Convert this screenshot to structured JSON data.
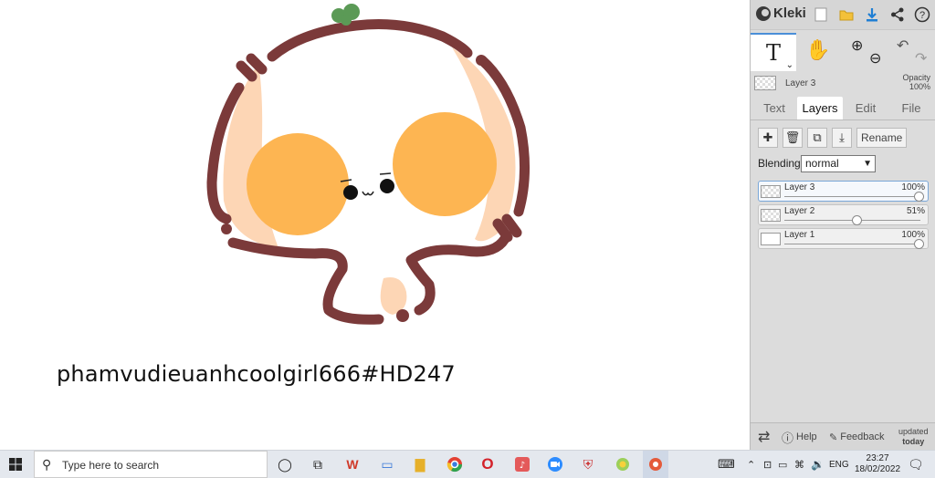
{
  "canvas": {
    "signature_text": "phamvudieuanhcoolgirl666#HD247"
  },
  "panel": {
    "brand": "Kleki",
    "toolbar_icons": [
      "new-file-icon",
      "open-folder-icon",
      "download-icon",
      "share-icon",
      "help-icon"
    ],
    "tool_text_label": "T",
    "active_layer_name": "Layer 3",
    "opacity_label": "Opacity",
    "opacity_value": "100%",
    "tabs": [
      "Text",
      "Layers",
      "Edit",
      "File"
    ],
    "active_tab": "Layers",
    "rename_label": "Rename",
    "blending_label": "Blending",
    "blending_value": "normal",
    "layers": [
      {
        "name": "Layer 3",
        "opacity_label": "100%",
        "opacity": 1.0,
        "selected": true
      },
      {
        "name": "Layer 2",
        "opacity_label": "51%",
        "opacity": 0.51,
        "selected": false
      },
      {
        "name": "Layer 1",
        "opacity_label": "100%",
        "opacity": 1.0,
        "selected": false
      }
    ],
    "bottom": {
      "help_label": "Help",
      "feedback_label": "Feedback",
      "updated_line1": "updated",
      "updated_line2": "today"
    }
  },
  "taskbar": {
    "search_placeholder": "Type here to search",
    "language": "ENG",
    "time": "23:27",
    "date": "18/02/2022"
  },
  "colors": {
    "outline": "#7b3a3a",
    "skin": "#fdd6b5",
    "cheek": "#fdb552",
    "sprout": "#5b9a56",
    "accent": "#4a8fd8"
  }
}
